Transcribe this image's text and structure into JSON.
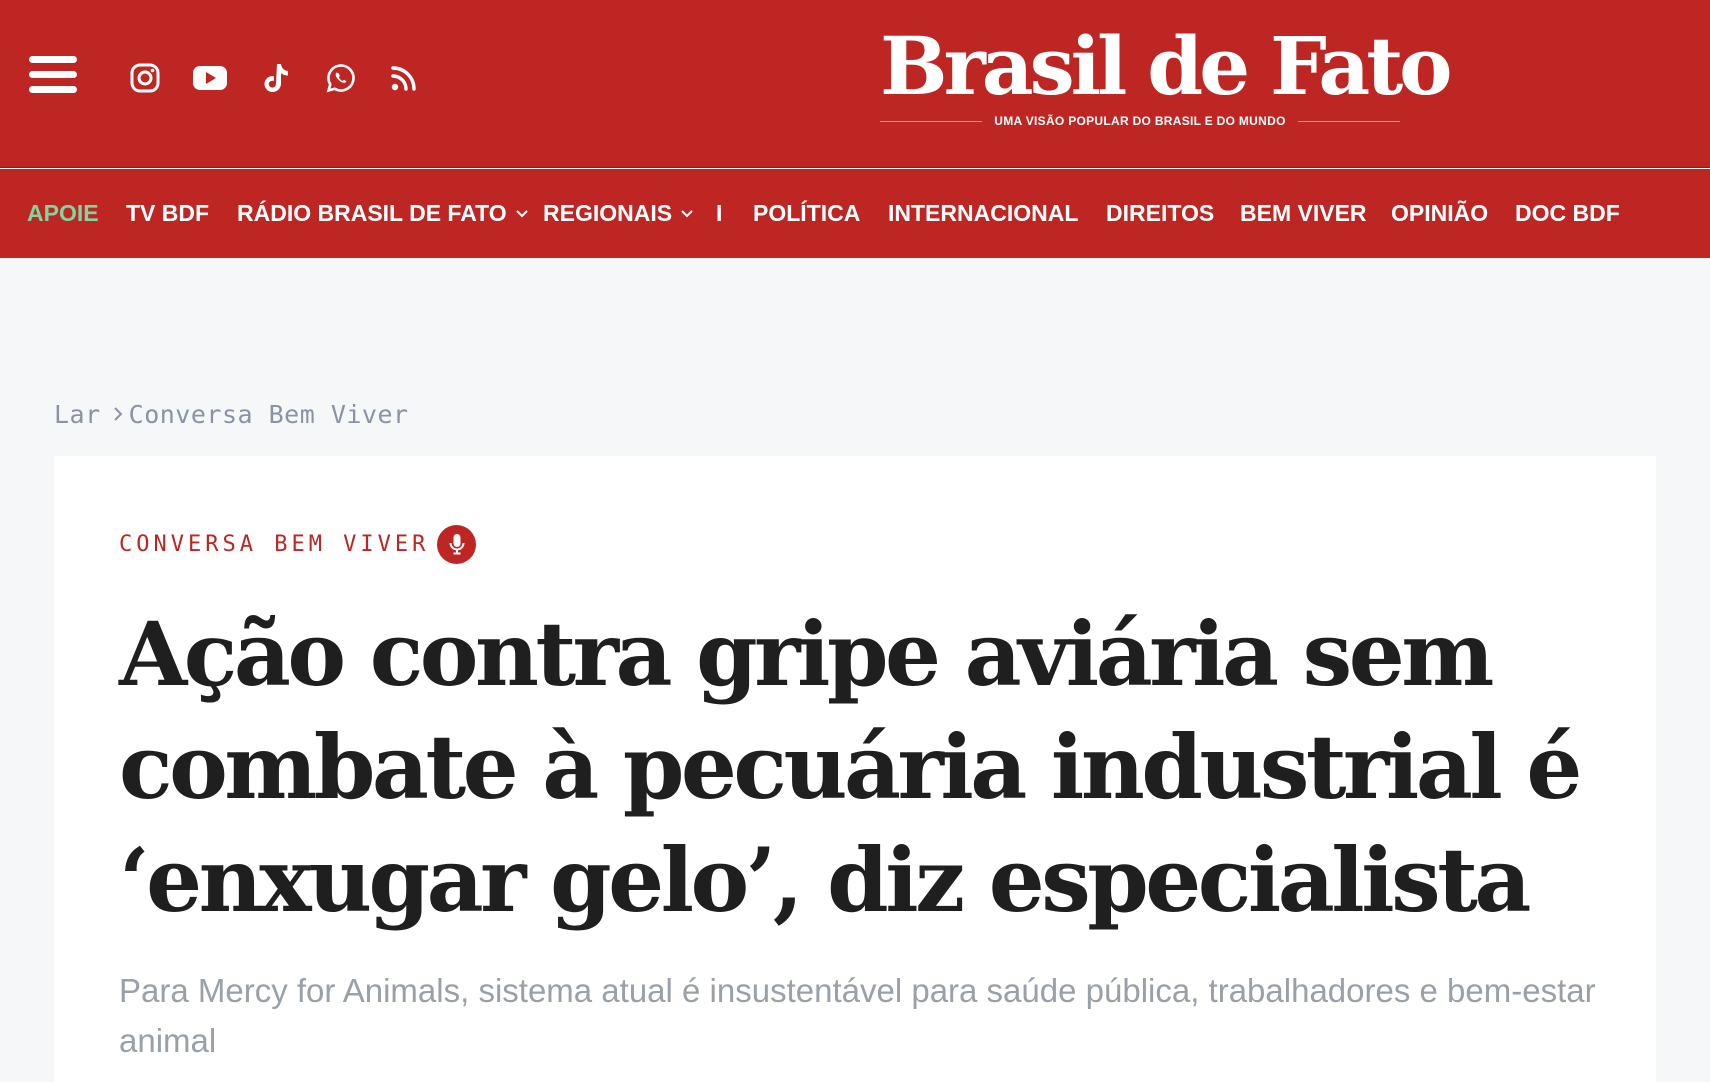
{
  "header": {
    "logo": {
      "name": "Brasil de Fato",
      "tagline": "UMA VISÃO POPULAR DO BRASIL E DO MUNDO"
    },
    "social_icons": [
      "instagram-icon",
      "youtube-icon",
      "tiktok-icon",
      "whatsapp-icon",
      "rss-icon"
    ],
    "colors": {
      "brand_red": "#bd2623",
      "apoie_green": "#7fd6a0"
    }
  },
  "nav": {
    "items": [
      {
        "label": "APOIE"
      },
      {
        "label": "TV BDF"
      },
      {
        "label": "RÁDIO BRASIL DE FATO"
      },
      {
        "label": "REGIONAIS"
      },
      {
        "label": "I"
      },
      {
        "label": "POLÍTICA"
      },
      {
        "label": "INTERNACIONAL"
      },
      {
        "label": "DIREITOS"
      },
      {
        "label": "BEM VIVER"
      },
      {
        "label": "OPINIÃO"
      },
      {
        "label": "DOC BDF"
      }
    ]
  },
  "breadcrumb": {
    "home": "Lar",
    "current": "Conversa Bem Viver"
  },
  "article": {
    "kicker": "CONVERSA BEM VIVER",
    "kicker_icon": "microphone-icon",
    "headline": "Ação contra gripe aviária sem combate à pecuária industrial é ‘enxugar gelo’, diz especialista",
    "subtitle": "Para Mercy for Animals, sistema atual é insustentável para saúde pública, trabalhadores e bem-estar animal"
  }
}
